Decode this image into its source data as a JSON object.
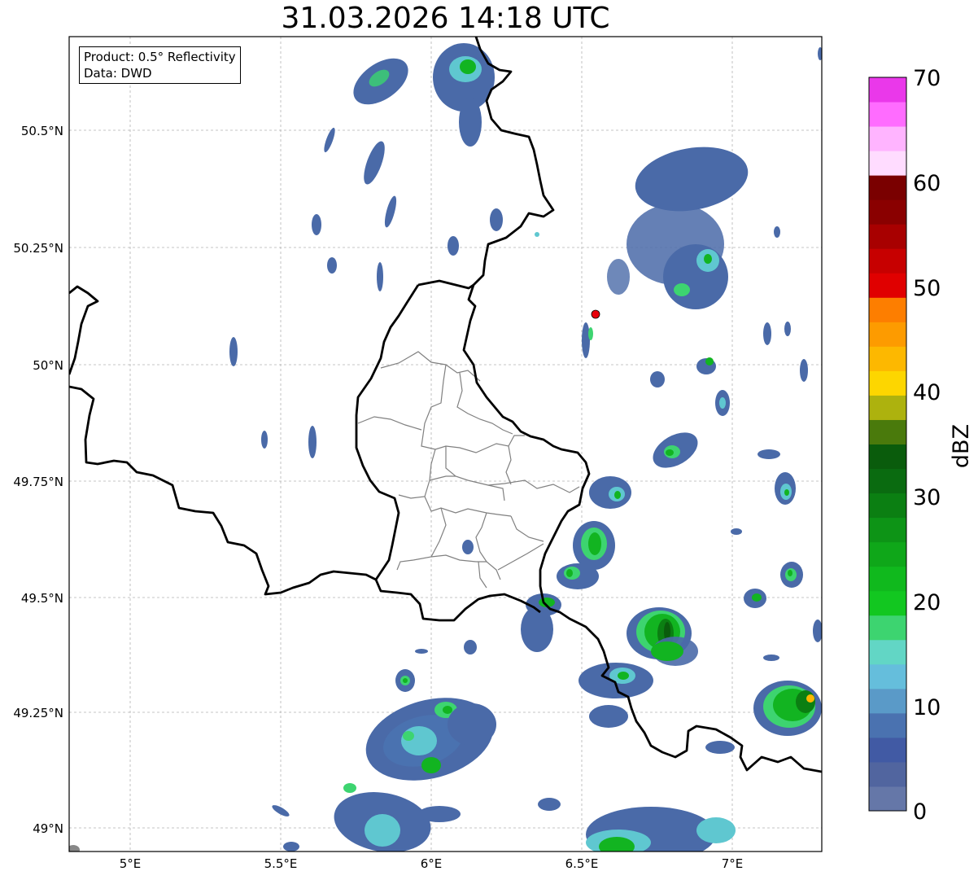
{
  "title": "31.03.2026 14:18 UTC",
  "info": {
    "product": "Product: 0.5° Reflectivity",
    "data": "Data: DWD"
  },
  "axes": {
    "lat_labels": [
      "50.5°N",
      "50.25°N",
      "50°N",
      "49.75°N",
      "49.5°N",
      "49.25°N",
      "49°N"
    ],
    "lon_labels": [
      "5°E",
      "5.5°E",
      "6°E",
      "6.5°E",
      "7°E"
    ]
  },
  "colorbar": {
    "label": "dBZ",
    "tick_labels": [
      "0",
      "10",
      "20",
      "30",
      "40",
      "50",
      "60",
      "70"
    ],
    "colors": [
      "#6577a8",
      "#51659f",
      "#415aa4",
      "#4a72b0",
      "#5a9ac8",
      "#65bedc",
      "#62d6c5",
      "#3dd470",
      "#12c720",
      "#10b91d",
      "#0fa719",
      "#0d9416",
      "#0b7f12",
      "#0a6b10",
      "#0a5c0c",
      "#4a7a0c",
      "#adb20e",
      "#fdd600",
      "#fdb800",
      "#fd9b00",
      "#fd7e00",
      "#e00000",
      "#c70000",
      "#a80000",
      "#8a0000",
      "#7a0000",
      "#ffdcff",
      "#ffb4ff",
      "#ff6cff",
      "#ea38ea"
    ]
  },
  "radar_site": {
    "name": "radar-site",
    "color": "#e8000b"
  }
}
